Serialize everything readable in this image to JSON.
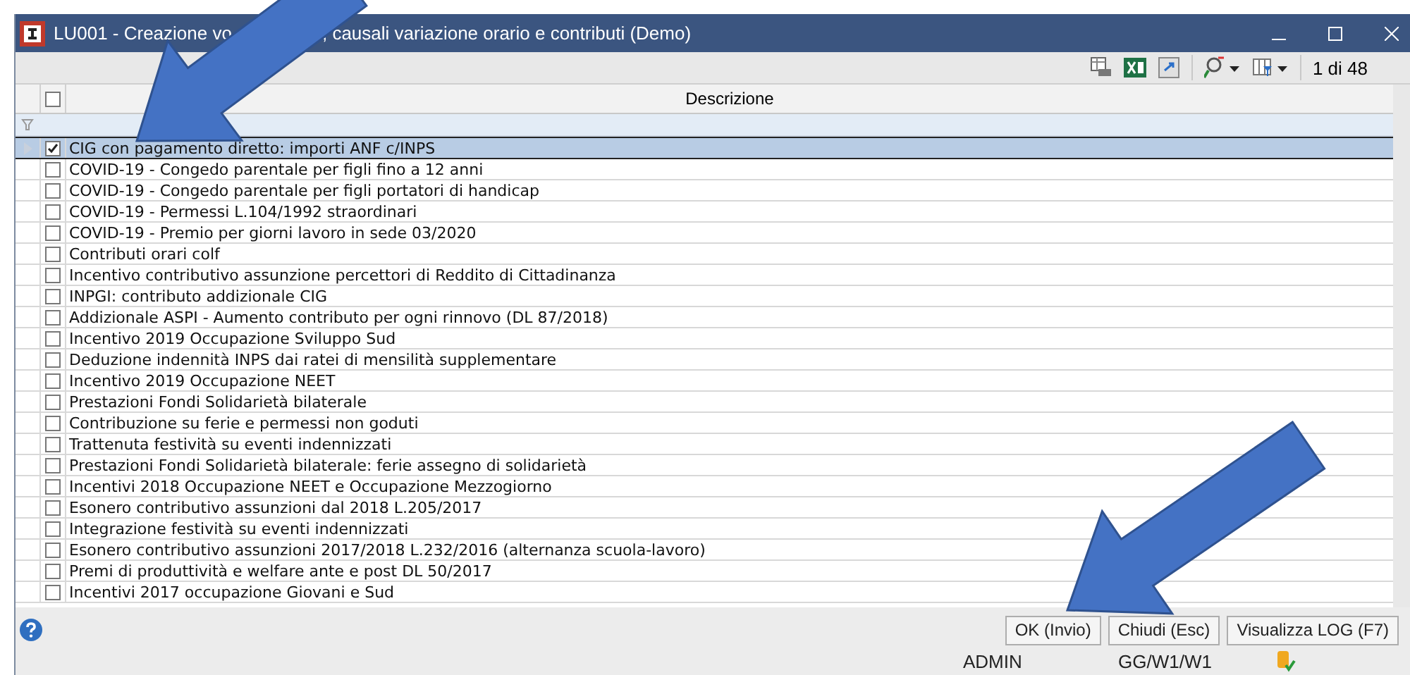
{
  "window": {
    "title_parts": [
      "LU001 - Creazione vo",
      ", causali variazione orario e contributi  (Demo)"
    ]
  },
  "toolbar": {
    "counter": "1 di 48"
  },
  "table": {
    "columns": [
      "Descrizione"
    ],
    "header_checked": false,
    "rows": [
      {
        "text": "CIG con pagamento diretto: importi ANF c/INPS",
        "checked": true,
        "selected": true
      },
      {
        "text": "COVID-19 - Congedo parentale per figli fino a 12 anni",
        "checked": false,
        "selected": false
      },
      {
        "text": "COVID-19 - Congedo parentale per figli portatori di handicap",
        "checked": false,
        "selected": false
      },
      {
        "text": "COVID-19 - Permessi L.104/1992 straordinari",
        "checked": false,
        "selected": false
      },
      {
        "text": "COVID-19 - Premio per giorni lavoro in sede 03/2020",
        "checked": false,
        "selected": false
      },
      {
        "text": "Contributi orari colf",
        "checked": false,
        "selected": false
      },
      {
        "text": "Incentivo contributivo assunzione percettori di Reddito di Cittadinanza",
        "checked": false,
        "selected": false
      },
      {
        "text": "INPGI: contributo addizionale CIG",
        "checked": false,
        "selected": false
      },
      {
        "text": "Addizionale ASPI - Aumento contributo per ogni rinnovo (DL 87/2018)",
        "checked": false,
        "selected": false
      },
      {
        "text": "Incentivo 2019 Occupazione Sviluppo Sud",
        "checked": false,
        "selected": false
      },
      {
        "text": "Deduzione indennità INPS dai ratei di mensilità supplementare",
        "checked": false,
        "selected": false
      },
      {
        "text": "Incentivo 2019 Occupazione NEET",
        "checked": false,
        "selected": false
      },
      {
        "text": "Prestazioni Fondi Solidarietà bilaterale",
        "checked": false,
        "selected": false
      },
      {
        "text": "Contribuzione su ferie e permessi non goduti",
        "checked": false,
        "selected": false
      },
      {
        "text": "Trattenuta festività su eventi indennizzati",
        "checked": false,
        "selected": false
      },
      {
        "text": "Prestazioni Fondi Solidarietà bilaterale: ferie assegno di solidarietà",
        "checked": false,
        "selected": false
      },
      {
        "text": "Incentivi 2018 Occupazione NEET e Occupazione Mezzogiorno",
        "checked": false,
        "selected": false
      },
      {
        "text": "Esonero contributivo assunzioni dal 2018 L.205/2017",
        "checked": false,
        "selected": false
      },
      {
        "text": "Integrazione festività su eventi indennizzati",
        "checked": false,
        "selected": false
      },
      {
        "text": "Esonero contributivo assunzioni 2017/2018 L.232/2016 (alternanza scuola-lavoro)",
        "checked": false,
        "selected": false
      },
      {
        "text": "Premi di produttività e welfare ante e post DL 50/2017",
        "checked": false,
        "selected": false
      },
      {
        "text": "Incentivi 2017 occupazione Giovani e Sud",
        "checked": false,
        "selected": false
      }
    ]
  },
  "buttons": [
    "OK (Invio)",
    "Chiudi (Esc)",
    "Visualizza LOG (F7)"
  ],
  "status_bar": {
    "user": "ADMIN",
    "path": "GG/W1/W1"
  }
}
